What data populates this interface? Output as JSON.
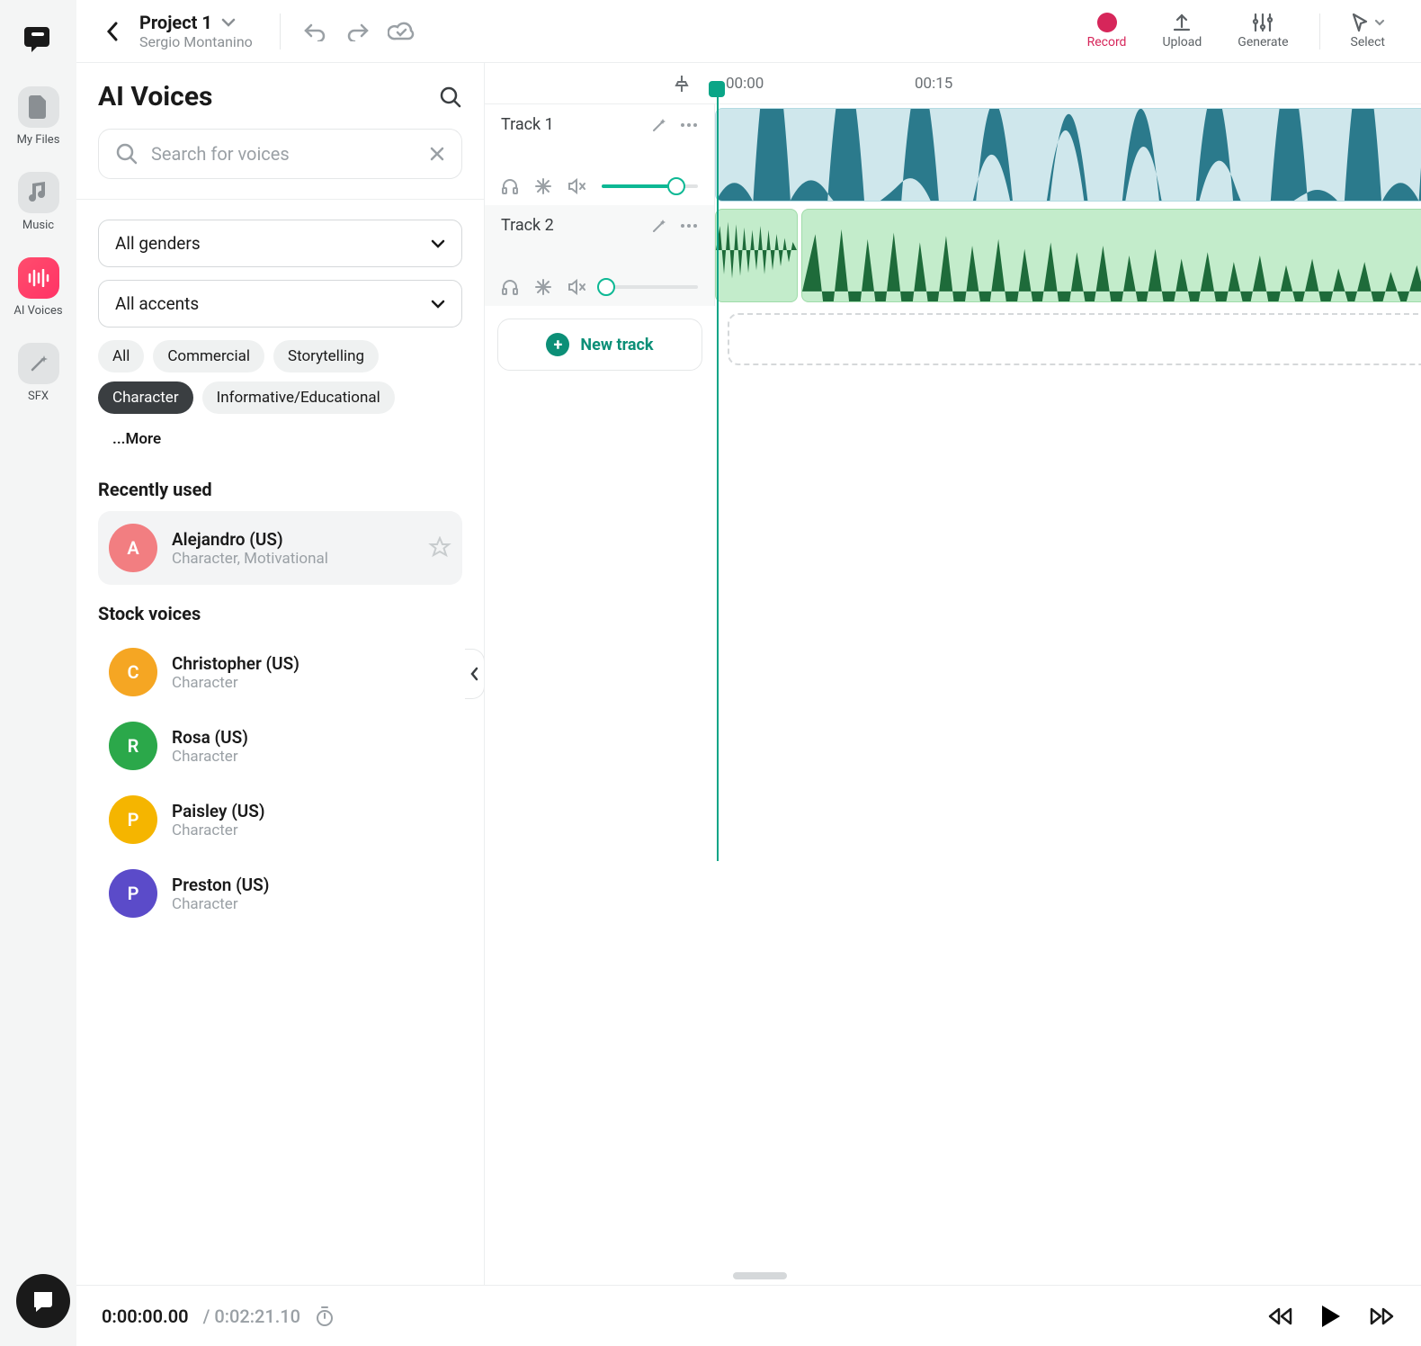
{
  "rail": {
    "items": [
      {
        "label": "My Files"
      },
      {
        "label": "Music"
      },
      {
        "label": "AI Voices"
      },
      {
        "label": "SFX"
      }
    ]
  },
  "topbar": {
    "project_name": "Project 1",
    "owner": "Sergio Montanino",
    "actions": {
      "record": "Record",
      "upload": "Upload",
      "generate": "Generate",
      "select": "Select"
    }
  },
  "panel": {
    "title": "AI Voices",
    "search_placeholder": "Search for voices",
    "gender_filter": "All genders",
    "accent_filter": "All accents",
    "chips": [
      "All",
      "Commercial",
      "Storytelling",
      "Character",
      "Informative/Educational"
    ],
    "active_chip": "Character",
    "more_label": "...More",
    "recently_used_h": "Recently used",
    "stock_h": "Stock voices",
    "recent": [
      {
        "initial": "A",
        "name": "Alejandro (US)",
        "tags": "Character, Motivational",
        "color": "#f27e81"
      }
    ],
    "stock": [
      {
        "initial": "C",
        "name": "Christopher (US)",
        "tags": "Character",
        "color": "#f5a623"
      },
      {
        "initial": "R",
        "name": "Rosa (US)",
        "tags": "Character",
        "color": "#2ba84a"
      },
      {
        "initial": "P",
        "name": "Paisley (US)",
        "tags": "Character",
        "color": "#f5b500"
      },
      {
        "initial": "P",
        "name": "Preston (US)",
        "tags": "Character",
        "color": "#5b4bc9"
      }
    ]
  },
  "timeline": {
    "ruler": {
      "t0": "00:00",
      "t15": "00:15"
    },
    "tracks": [
      {
        "name": "Track 1",
        "volume": 0.78
      },
      {
        "name": "Track 2",
        "volume": 0.05
      }
    ],
    "new_track": "New track"
  },
  "footer": {
    "current": "0:00:00.00",
    "sep": " / ",
    "total": "0:02:21.10"
  }
}
